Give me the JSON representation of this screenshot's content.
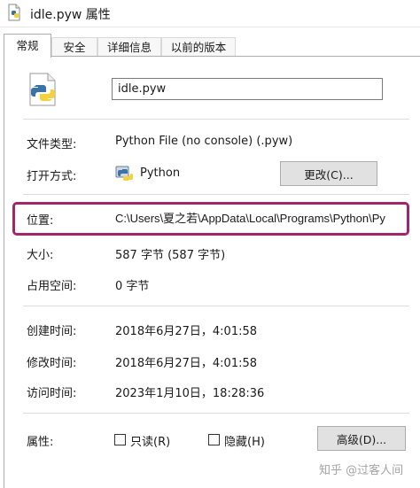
{
  "window": {
    "title": "idle.pyw 属性"
  },
  "tabs": [
    {
      "label": "常规",
      "active": true
    },
    {
      "label": "安全",
      "active": false
    },
    {
      "label": "详细信息",
      "active": false
    },
    {
      "label": "以前的版本",
      "active": false
    }
  ],
  "file": {
    "name": "idle.pyw"
  },
  "details": {
    "type_label": "文件类型:",
    "type_value": "Python File (no console) (.pyw)",
    "open_label": "打开方式:",
    "open_app": "Python",
    "change_button": "更改(C)...",
    "location_label": "位置:",
    "location_value": "C:\\Users\\夏之若\\AppData\\Local\\Programs\\Python\\Py",
    "size_label": "大小:",
    "size_value": "587 字节 (587 字节)",
    "disk_label": "占用空间:",
    "disk_value": "0 字节",
    "created_label": "创建时间:",
    "created_value": "2018年6月27日，4:01:58",
    "modified_label": "修改时间:",
    "modified_value": "2018年6月27日，4:01:58",
    "accessed_label": "访问时间:",
    "accessed_value": "2023年1月10日，18:28:36",
    "attributes_label": "属性:",
    "readonly_label": "只读(R)",
    "readonly_checked": false,
    "hidden_label": "隐藏(H)",
    "hidden_checked": false,
    "advanced_button": "高级(D)..."
  },
  "watermark": "知乎 @过客人间",
  "colors": {
    "highlight": "#a3266b",
    "python_blue": "#3a73a8",
    "python_yellow": "#f5d13d"
  }
}
